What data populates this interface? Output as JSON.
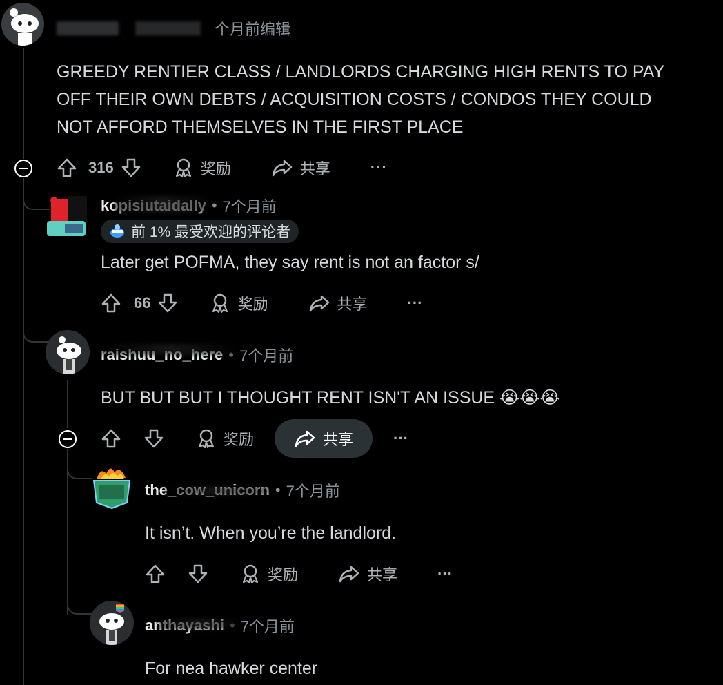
{
  "top_comment": {
    "meta_text": "个月前编辑",
    "body_lines": [
      "GREEDY RENTIER CLASS / LANDLORDS CHARGING HIGH RENTS TO PAY",
      "OFF THEIR OWN DEBTS / ACQUISITION COSTS / CONDOS THEY COULD",
      "NOT AFFORD THEMSELVES IN THE FIRST PLACE"
    ],
    "votes": "316",
    "award_label": "奖励",
    "share_label": "共享",
    "more_label": "···"
  },
  "reply1": {
    "username": "kopisiutaidally",
    "time": "7个月前",
    "badge": "前 1% 最受欢迎的评论者",
    "body": "Later get POFMA, they say rent is not an factor s/",
    "votes": "66",
    "award_label": "奖励",
    "share_label": "共享",
    "more_label": "···"
  },
  "reply2": {
    "username": "raishuu_no_here",
    "time": "7个月前",
    "body": "BUT BUT BUT I THOUGHT RENT ISN'T AN ISSUE 😭😭😭",
    "votes": "",
    "award_label": "奖励",
    "share_label": "共享",
    "more_label": "···"
  },
  "reply3": {
    "username": "the_cow_unicorn",
    "time": "7个月前",
    "body": "It isn’t. When you’re the landlord.",
    "votes": "",
    "award_label": "奖励",
    "share_label": "共享",
    "more_label": "···"
  },
  "reply4": {
    "username": "anthayashi",
    "time": "7个月前",
    "body": "For nea hawker center"
  },
  "colors": {
    "background": "#000000",
    "text": "#d7dadc",
    "muted": "#8b9398",
    "thread_line": "#343536",
    "share_active_bg": "#2a3236"
  }
}
